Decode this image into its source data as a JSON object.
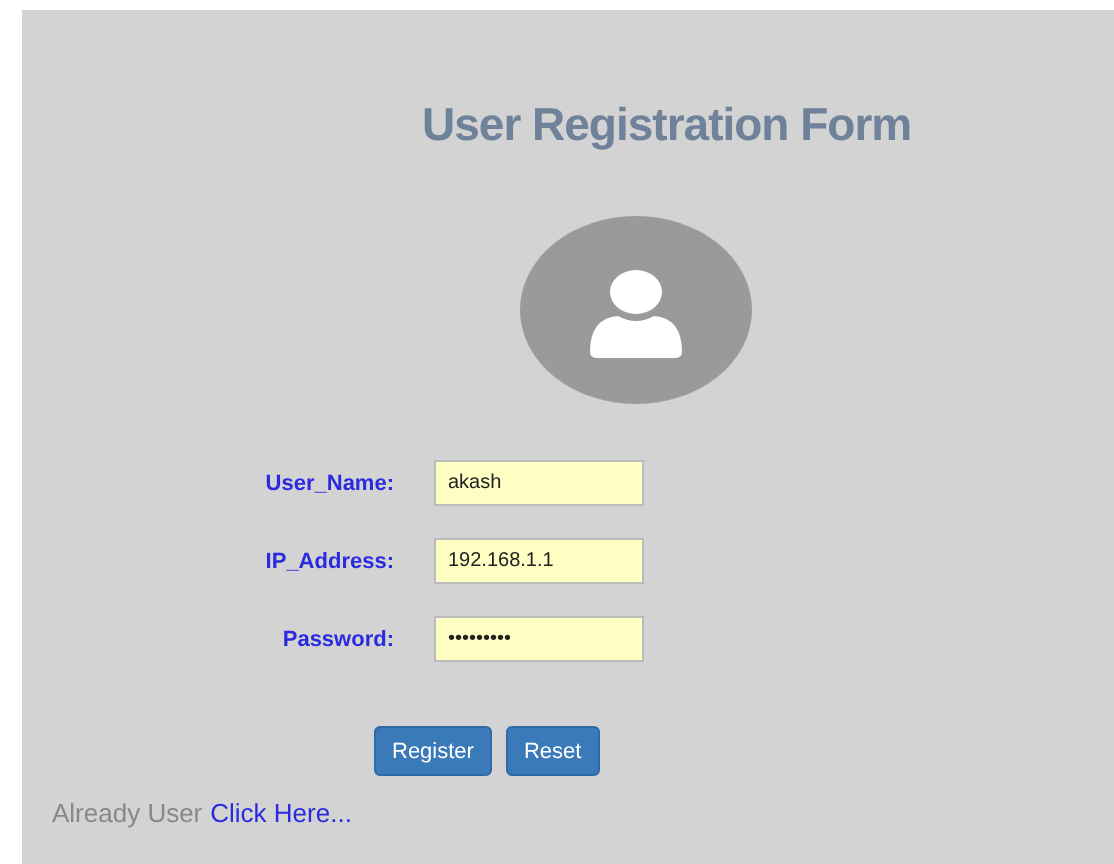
{
  "title": "User Registration Form",
  "fields": [
    {
      "label": "User_Name:",
      "value": "akash"
    },
    {
      "label": "IP_Address:",
      "value": "192.168.1.1"
    },
    {
      "label": "Password:",
      "value": "•••••••••"
    }
  ],
  "buttons": [
    "Register",
    "Reset"
  ],
  "footer": {
    "text": "Already User",
    "link": "Click Here..."
  }
}
